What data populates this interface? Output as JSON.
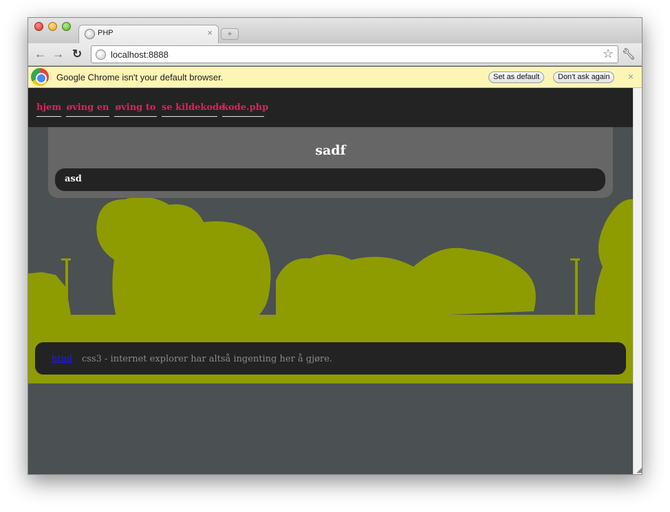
{
  "browser": {
    "tab_title": "PHP",
    "url": "localhost:8888",
    "infobar": {
      "message": "Google Chrome isn't your default browser.",
      "set_default_label": "Set as default",
      "dont_ask_label": "Don't ask again"
    }
  },
  "site": {
    "nav": [
      "hjem",
      "øving en",
      "øving to",
      "se kildekode",
      "kode.php"
    ],
    "heading": "sadf",
    "content_text": "asd",
    "footer": {
      "link_text": "html",
      "text": "css3 - internet explorer har altså ingenting her å gjøre."
    },
    "colors": {
      "accent": "#e0205d",
      "foliage": "#8e9c00",
      "background": "#4b5052",
      "panel": "#666666",
      "dark": "#232323"
    }
  }
}
